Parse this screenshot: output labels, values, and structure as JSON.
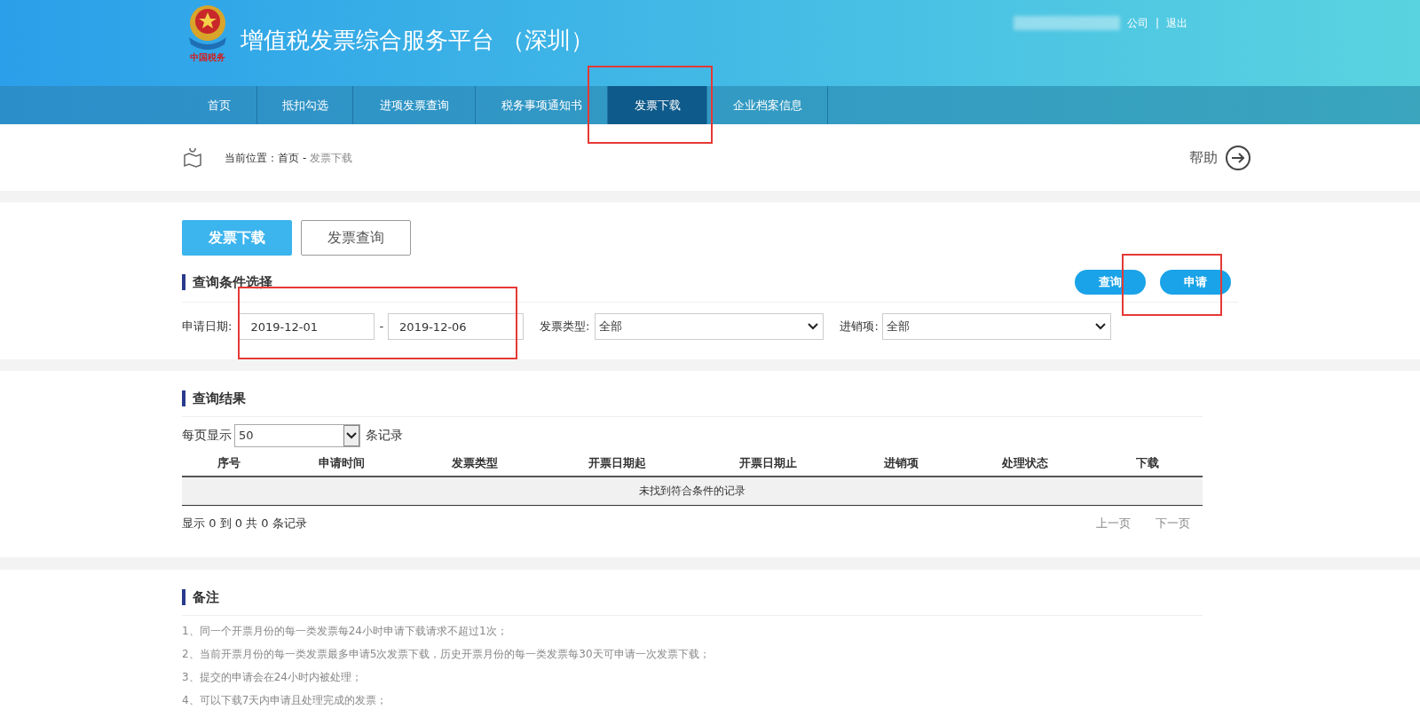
{
  "header": {
    "title": "增值税发票综合服务平台 （深圳）",
    "logo_text": "中国税务",
    "user_suffix": "公司",
    "separator": "|",
    "logout": "退出"
  },
  "nav": [
    {
      "label": "首页",
      "selected": false
    },
    {
      "label": "抵扣勾选",
      "selected": false
    },
    {
      "label": "进项发票查询",
      "selected": false
    },
    {
      "label": "税务事项通知书",
      "selected": false
    },
    {
      "label": "发票下载",
      "selected": true
    },
    {
      "label": "企业档案信息",
      "selected": false
    }
  ],
  "breadcrumb": {
    "label": "当前位置：",
    "home": "首页",
    "separator": "-",
    "current": "发票下载"
  },
  "help": "帮助",
  "tabs": [
    {
      "label": "发票下载",
      "selected": true
    },
    {
      "label": "发票查询",
      "selected": false
    }
  ],
  "query": {
    "title": "查询条件选择",
    "buttons": [
      "查询",
      "申请"
    ],
    "date_label": "申请日期:",
    "date_from": "2019-12-01",
    "date_separator": "-",
    "date_to": "2019-12-06",
    "type_label": "发票类型:",
    "type_value": "全部",
    "direction_label": "进销项:",
    "direction_value": "全部"
  },
  "results": {
    "title": "查询结果",
    "page_size_label": "每页显示",
    "page_size": "50",
    "records_label": "条记录",
    "columns": [
      "序号",
      "申请时间",
      "发票类型",
      "开票日期起",
      "开票日期止",
      "进销项",
      "处理状态",
      "下载"
    ],
    "empty_message": "未找到符合条件的记录",
    "summary": "显示 0 到 0 共 0 条记录",
    "prev": "上一页",
    "next": "下一页"
  },
  "notes": {
    "title": "备注",
    "items": [
      "1、同一个开票月份的每一类发票每24小时申请下载请求不超过1次；",
      "2、当前开票月份的每一类发票最多申请5次发票下载，历史开票月份的每一类发票每30天可申请一次发票下载；",
      "3、提交的申请会在24小时内被处理；",
      "4、可以下载7天内申请且处理完成的发票；"
    ]
  }
}
